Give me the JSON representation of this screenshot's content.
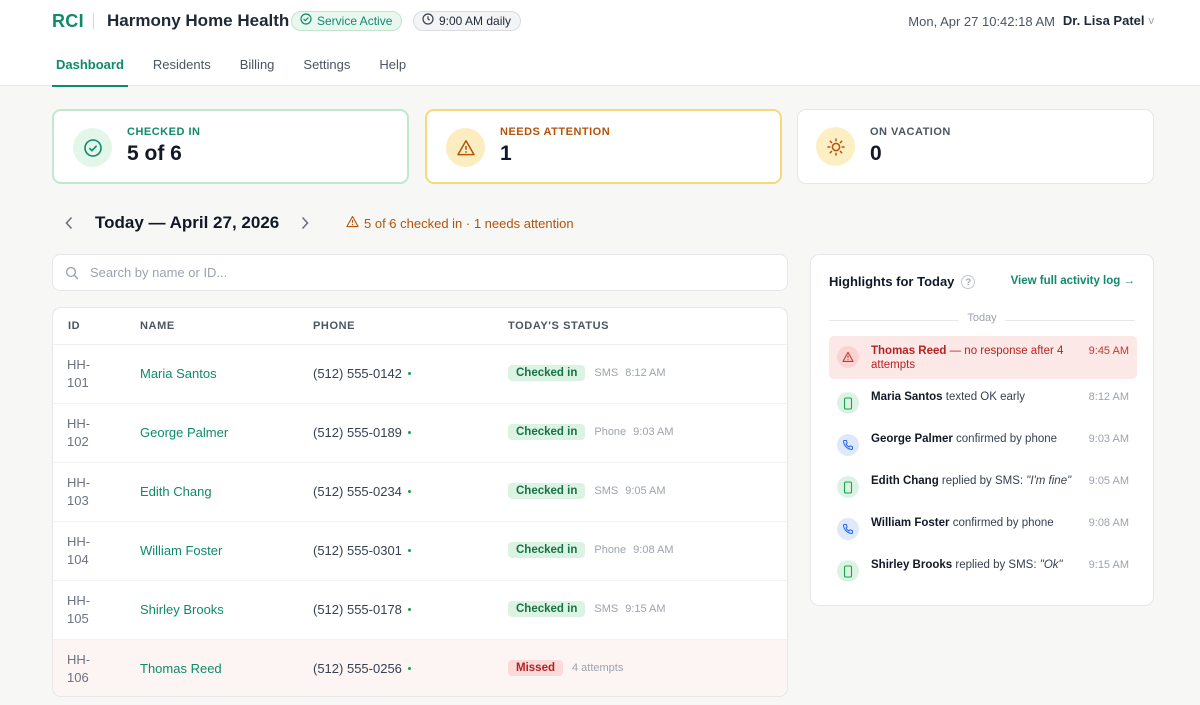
{
  "header": {
    "brand": "RCI",
    "org_name": "Harmony Home Health",
    "service_status": "Service Active",
    "schedule": "9:00 AM daily",
    "datetime": "Mon, Apr 27 10:42:18 AM",
    "user_name": "Dr. Lisa Patel",
    "user_chevron": "v"
  },
  "tabs": [
    {
      "label": "Dashboard",
      "active": true
    },
    {
      "label": "Residents",
      "active": false
    },
    {
      "label": "Billing",
      "active": false
    },
    {
      "label": "Settings",
      "active": false
    },
    {
      "label": "Help",
      "active": false
    }
  ],
  "stats": {
    "checked_in": {
      "label": "CHECKED IN",
      "value": "5 of 6"
    },
    "needs_attention": {
      "label": "NEEDS ATTENTION",
      "value": "1"
    },
    "on_vacation": {
      "label": "ON VACATION",
      "value": "0"
    }
  },
  "date_nav": {
    "title": "Today — April 27, 2026",
    "summary": "5 of 6 checked in · 1 needs attention"
  },
  "search": {
    "placeholder": "Search by name or ID..."
  },
  "table": {
    "headers": {
      "id": "ID",
      "name": "NAME",
      "phone": "PHONE",
      "status": "TODAY'S STATUS"
    },
    "rows": [
      {
        "id_a": "HH-",
        "id_b": "101",
        "name": "Maria Santos",
        "phone": "(512) 555-0142",
        "status": "Checked in",
        "method": "SMS",
        "time": "8:12 AM"
      },
      {
        "id_a": "HH-",
        "id_b": "102",
        "name": "George Palmer",
        "phone": "(512) 555-0189",
        "status": "Checked in",
        "method": "Phone",
        "time": "9:03 AM"
      },
      {
        "id_a": "HH-",
        "id_b": "103",
        "name": "Edith Chang",
        "phone": "(512) 555-0234",
        "status": "Checked in",
        "method": "SMS",
        "time": "9:05 AM"
      },
      {
        "id_a": "HH-",
        "id_b": "104",
        "name": "William Foster",
        "phone": "(512) 555-0301",
        "status": "Checked in",
        "method": "Phone",
        "time": "9:08 AM"
      },
      {
        "id_a": "HH-",
        "id_b": "105",
        "name": "Shirley Brooks",
        "phone": "(512) 555-0178",
        "status": "Checked in",
        "method": "SMS",
        "time": "9:15 AM"
      },
      {
        "id_a": "HH-",
        "id_b": "106",
        "name": "Thomas Reed",
        "phone": "(512) 555-0256",
        "status": "Missed",
        "method": "4 attempts",
        "time": ""
      }
    ]
  },
  "highlights": {
    "title": "Highlights for Today",
    "help": "?",
    "link": "View full activity log →",
    "divider": "Today",
    "items": [
      {
        "name": "Thomas Reed",
        "text_a": " — no response after 4",
        "text_b": "attempts",
        "time": "9:45 AM"
      },
      {
        "name": "Maria Santos",
        "text_a": " texted OK early",
        "time": "8:12 AM"
      },
      {
        "name": "George Palmer",
        "text_a": " confirmed by phone",
        "time": "9:03 AM"
      },
      {
        "name": "Edith Chang",
        "text_a": " replied by SMS: ",
        "quote": "\"I'm fine\"",
        "time": "9:05 AM"
      },
      {
        "name": "William Foster",
        "text_a": " confirmed by phone",
        "time": "9:08 AM"
      },
      {
        "name": "Shirley Brooks",
        "text_a": " replied by SMS: ",
        "quote": "\"Ok\"",
        "time": "9:15 AM"
      }
    ]
  },
  "colors": {
    "accent": "#0f8a6b",
    "warning": "#b45309",
    "danger": "#b42323"
  }
}
